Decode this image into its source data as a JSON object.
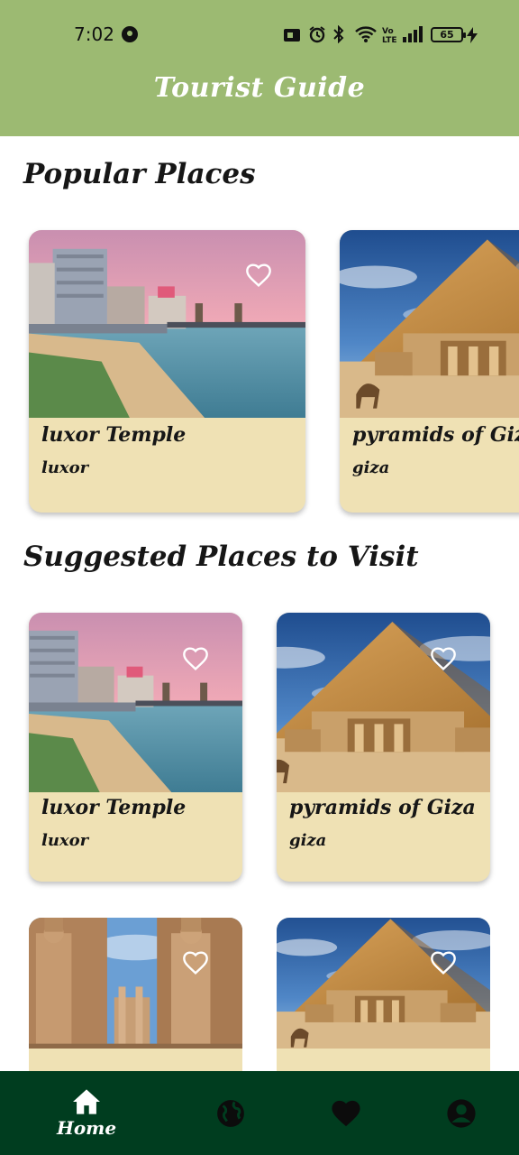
{
  "status_bar": {
    "time": "7:02",
    "battery": "65",
    "icons": [
      "media-icon",
      "alarm-icon",
      "bluetooth-icon",
      "wifi-icon",
      "volte-icon",
      "signal-icon",
      "battery-icon",
      "charging-icon"
    ]
  },
  "app_bar": {
    "title": "Tourist Guide",
    "color": "#9cba72"
  },
  "popular": {
    "title": "Popular Places",
    "cards": [
      {
        "name": "luxor Temple",
        "city": "luxor",
        "image": "alexandria-beach"
      },
      {
        "name": "pyramids of Giza",
        "city": "giza",
        "image": "pyramid"
      }
    ]
  },
  "suggested": {
    "title": "Suggested Places to Visit",
    "cards": [
      {
        "name": "luxor Temple",
        "city": "luxor",
        "image": "alexandria-beach"
      },
      {
        "name": "pyramids of Giza",
        "city": "giza",
        "image": "pyramid"
      },
      {
        "name": "",
        "city": "",
        "image": "luxor-statues"
      },
      {
        "name": "",
        "city": "",
        "image": "pyramid"
      }
    ]
  },
  "bottom_nav": {
    "color": "#003d1f",
    "items": [
      {
        "label": "Home",
        "icon": "home-icon",
        "active": true
      },
      {
        "label": "",
        "icon": "globe-icon",
        "active": false
      },
      {
        "label": "",
        "icon": "heart-icon",
        "active": false
      },
      {
        "label": "",
        "icon": "account-icon",
        "active": false
      }
    ]
  },
  "colors": {
    "card": "#efe1b4",
    "accent": "#9cba72",
    "nav": "#003d1f"
  }
}
